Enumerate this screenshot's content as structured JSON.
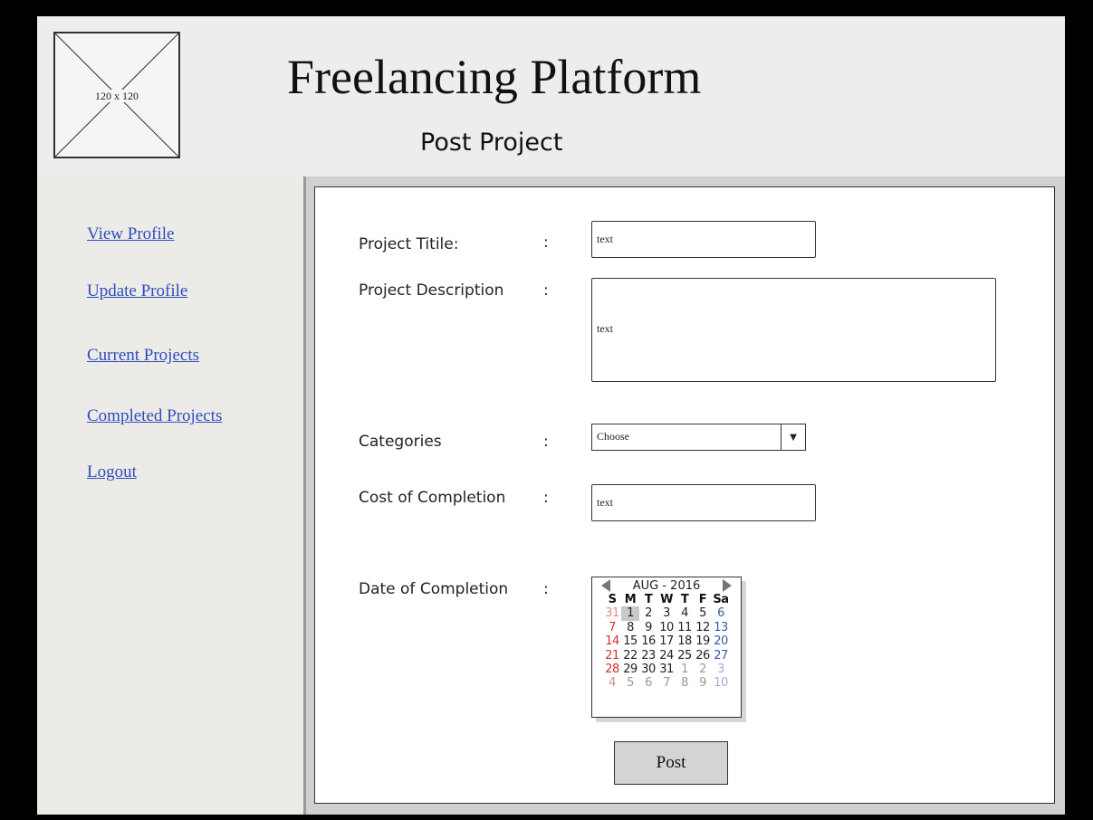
{
  "header": {
    "logo_placeholder": "120 x 120",
    "app_title": "Freelancing Platform",
    "page_title": "Post Project"
  },
  "sidebar": {
    "items": [
      {
        "label": "View Profile"
      },
      {
        "label": "Update Profile"
      },
      {
        "label": "Current Projects"
      },
      {
        "label": "Completed Projects"
      },
      {
        "label": "Logout"
      }
    ]
  },
  "form": {
    "colon": ":",
    "project_title": {
      "label": "Project Titile:",
      "value": "text"
    },
    "project_description": {
      "label": "Project Description",
      "value": "text"
    },
    "categories": {
      "label": "Categories",
      "value": "Choose",
      "arrow": "▼"
    },
    "cost": {
      "label": "Cost of Completion",
      "value": "text"
    },
    "date": {
      "label": "Date of Completion"
    },
    "post_button": "Post"
  },
  "calendar": {
    "month_label": "AUG - 2016",
    "weekdays": [
      "S",
      "M",
      "T",
      "W",
      "T",
      "F",
      "Sa"
    ],
    "weeks": [
      [
        "31",
        "1",
        "2",
        "3",
        "4",
        "5",
        "6"
      ],
      [
        "7",
        "8",
        "9",
        "10",
        "11",
        "12",
        "13"
      ],
      [
        "14",
        "15",
        "16",
        "17",
        "18",
        "19",
        "20"
      ],
      [
        "21",
        "22",
        "23",
        "24",
        "25",
        "26",
        "27"
      ],
      [
        "28",
        "29",
        "30",
        "31",
        "1",
        "2",
        "3"
      ],
      [
        "4",
        "5",
        "6",
        "7",
        "8",
        "9",
        "10"
      ]
    ],
    "selected_day": "1",
    "icons": {
      "prev": "triangle-left-icon",
      "next": "triangle-right-icon"
    },
    "colors": {
      "sunday": "#c33",
      "saturday": "#3a5aa8",
      "other_month": "#999",
      "selected_bg": "#c9c9c9"
    }
  }
}
